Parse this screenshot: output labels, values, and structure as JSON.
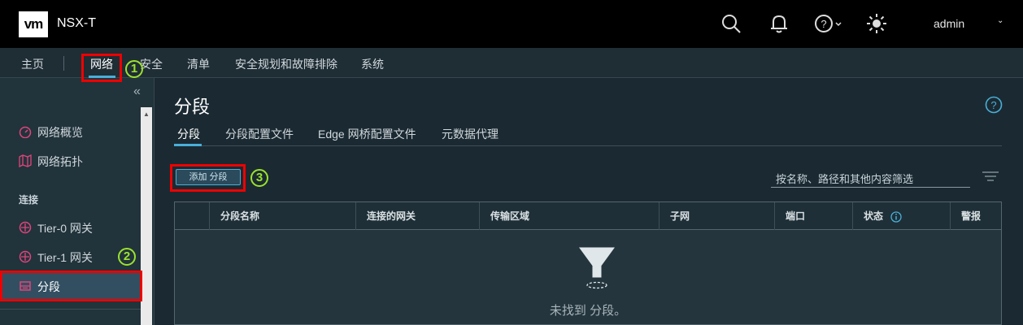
{
  "app": {
    "logo": "vm",
    "title": "NSX-T",
    "user": "admin"
  },
  "topbar_icons": [
    "search-icon",
    "bell-icon",
    "help-icon",
    "sun-icon"
  ],
  "nav": {
    "items": [
      {
        "label": "主页"
      },
      {
        "label": "网络",
        "active": true
      },
      {
        "label": "安全"
      },
      {
        "label": "清单"
      },
      {
        "label": "安全规划和故障排除"
      },
      {
        "label": "系统"
      }
    ]
  },
  "annotations": {
    "step1": "1",
    "step2": "2",
    "step3": "3",
    "color": "#9be22d",
    "box_color": "#ee0000"
  },
  "sidebar": {
    "items": [
      {
        "label": "网络概览",
        "icon": "gauge-icon"
      },
      {
        "label": "网络拓扑",
        "icon": "map-icon"
      }
    ],
    "section": "连接",
    "conn_items": [
      {
        "label": "Tier-0 网关",
        "icon": "router-icon"
      },
      {
        "label": "Tier-1 网关",
        "icon": "router-icon"
      },
      {
        "label": "分段",
        "icon": "segment-icon",
        "active": true
      }
    ]
  },
  "main": {
    "title": "分段",
    "tabs": [
      {
        "label": "分段",
        "active": true
      },
      {
        "label": "分段配置文件"
      },
      {
        "label": "Edge 网桥配置文件"
      },
      {
        "label": "元数据代理"
      }
    ],
    "add_button": "添加 分段",
    "filter_placeholder": "按名称、路径和其他内容筛选",
    "columns": [
      "分段名称",
      "连接的网关",
      "传输区域",
      "子网",
      "端口",
      "状态",
      "警报"
    ],
    "empty_text": "未找到 分段。"
  },
  "colors": {
    "accent": "#49afd9",
    "icon_pink": "#e0457b",
    "topbar": "#000000"
  }
}
